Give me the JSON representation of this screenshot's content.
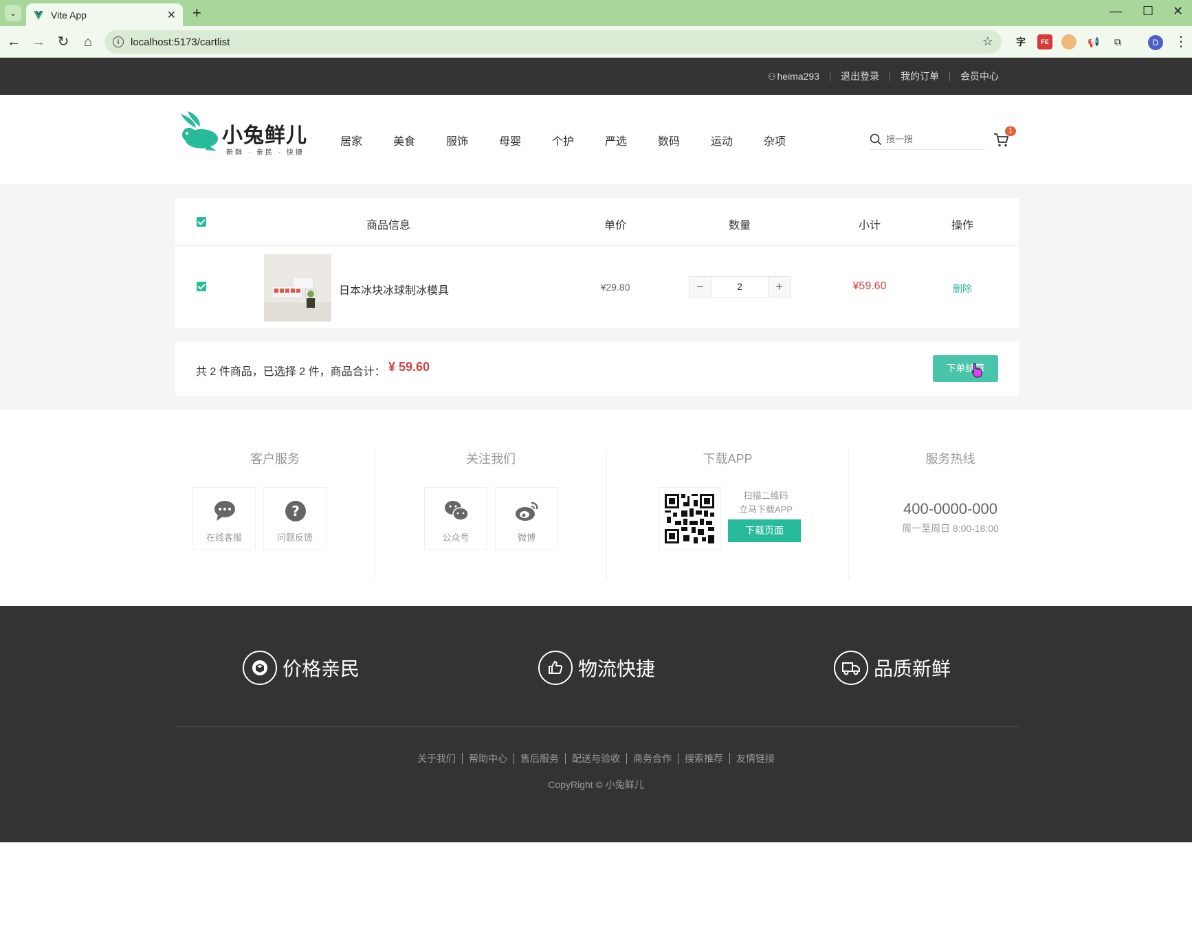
{
  "browser": {
    "tab_title": "Vite App",
    "url": "localhost:5173/cartlist",
    "profile_initial": "D"
  },
  "topnav": {
    "username": "heima293",
    "logout": "退出登录",
    "orders": "我的订单",
    "member": "会员中心"
  },
  "header": {
    "logo_text": "小兔鲜儿",
    "logo_slogan": "新鲜 · 亲民 · 快捷",
    "categories": [
      "居家",
      "美食",
      "服饰",
      "母婴",
      "个护",
      "严选",
      "数码",
      "运动",
      "杂项"
    ],
    "search_placeholder": "搜一搜",
    "cart_count": "1"
  },
  "cart": {
    "columns": {
      "info": "商品信息",
      "price": "单价",
      "quantity": "数量",
      "subtotal": "小计",
      "action": "操作"
    },
    "items": [
      {
        "name": "日本冰块冰球制冰模具",
        "price": "¥29.80",
        "quantity": "2",
        "subtotal": "¥59.60",
        "delete_label": "删除",
        "checked": true
      }
    ],
    "summary_text": "共 2 件商品，已选择 2 件，商品合计：",
    "total": "¥ 59.60",
    "order_button": "下单结算"
  },
  "services": {
    "customer_service": {
      "title": "客户服务",
      "online": "在线客服",
      "feedback": "问题反馈"
    },
    "follow": {
      "title": "关注我们",
      "wechat": "公众号",
      "weibo": "微博"
    },
    "app": {
      "title": "下载APP",
      "line1": "扫描二维码",
      "line2": "立马下载APP",
      "button": "下载页面"
    },
    "hotline": {
      "title": "服务热线",
      "phone": "400-0000-000",
      "hours": "周一至周日 8:00-18:00"
    }
  },
  "footer": {
    "promises": [
      "价格亲民",
      "物流快捷",
      "品质新鲜"
    ],
    "links": [
      "关于我们",
      "帮助中心",
      "售后服务",
      "配送与验收",
      "商务合作",
      "搜索推荐",
      "友情链接"
    ],
    "copyright": "CopyRight © 小兔鲜儿"
  },
  "colors": {
    "brand": "#27ba9b",
    "price_red": "#cf4444",
    "dark": "#333333",
    "chrome_green": "#a8d69b"
  }
}
